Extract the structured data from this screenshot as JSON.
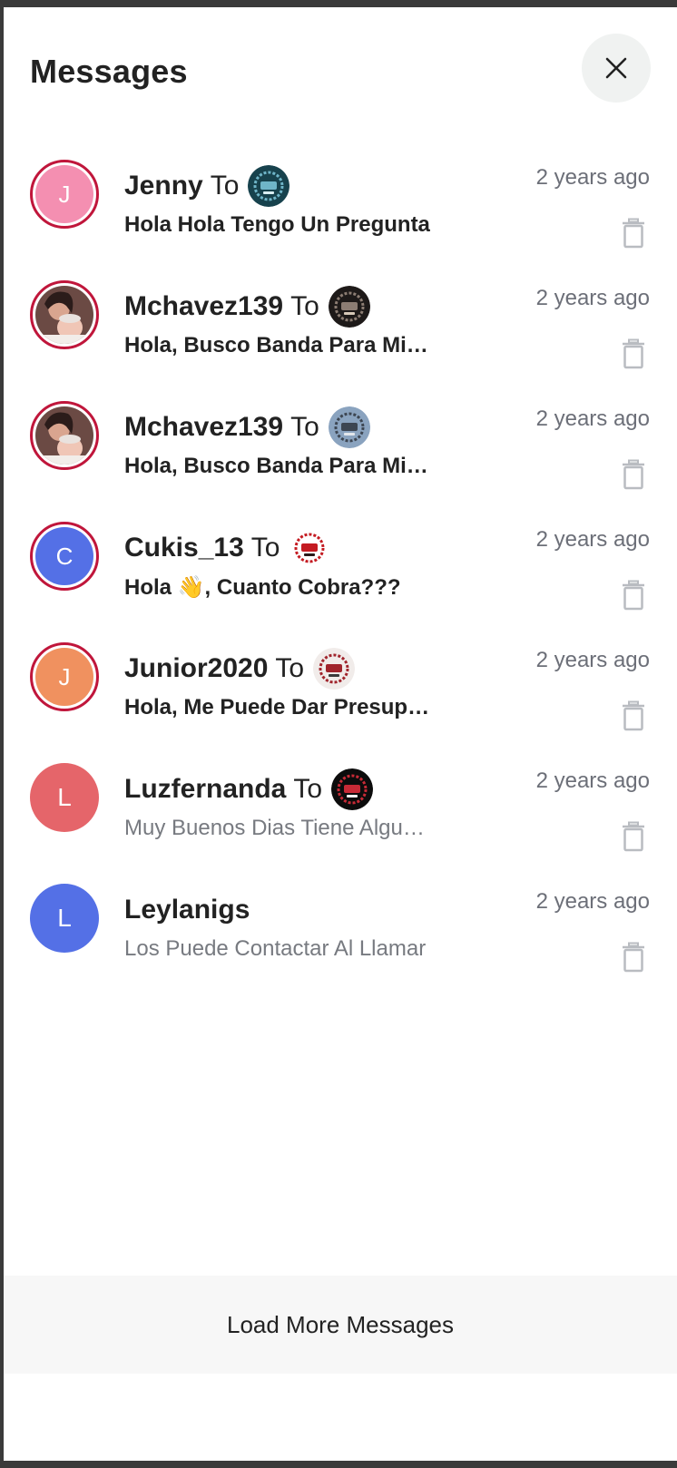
{
  "header": {
    "title": "Messages",
    "close_icon": "close-icon"
  },
  "colors": {
    "ring": "#c0163b",
    "timestamp": "#6c6f78",
    "read_preview": "#777a80",
    "footer_bg": "#f7f7f7"
  },
  "messages": [
    {
      "initial": "J",
      "avatar_color": "#f48fb1",
      "avatar_type": "initial",
      "ring": true,
      "sender": "Jenny",
      "to_label": "To",
      "recipient_icon": "band-logo-teal",
      "preview": "Hola Hola Tengo Un Pregunta",
      "unread": true,
      "time": "2 years ago",
      "delete_icon": "trash-icon"
    },
    {
      "initial": "",
      "avatar_color": "#c98b7b",
      "avatar_type": "photo",
      "ring": true,
      "sender": "Mchavez139",
      "to_label": "To",
      "recipient_icon": "band-logo-dark",
      "preview": "Hola, Busco Banda Para Mi Evento",
      "unread": true,
      "time": "2 years ago",
      "delete_icon": "trash-icon"
    },
    {
      "initial": "",
      "avatar_color": "#c98b7b",
      "avatar_type": "photo",
      "ring": true,
      "sender": "Mchavez139",
      "to_label": "To",
      "recipient_icon": "band-logo-grey",
      "preview": "Hola, Busco Banda Para Mi Evento",
      "unread": true,
      "time": "2 years ago",
      "delete_icon": "trash-icon"
    },
    {
      "initial": "C",
      "avatar_color": "#5470e6",
      "avatar_type": "initial",
      "ring": true,
      "sender": "Cukis_13",
      "to_label": "To",
      "recipient_icon": "band-logo-red",
      "preview": "Hola 👋, Cuanto Cobra???",
      "unread": true,
      "time": "2 years ago",
      "delete_icon": "trash-icon"
    },
    {
      "initial": "J",
      "avatar_color": "#f0915f",
      "avatar_type": "initial",
      "ring": true,
      "sender": "Junior2020",
      "to_label": "To",
      "recipient_icon": "band-logo-group",
      "preview": "Hola, Me Puede Dar Presupuesto",
      "unread": true,
      "time": "2 years ago",
      "delete_icon": "trash-icon"
    },
    {
      "initial": "L",
      "avatar_color": "#e5656a",
      "avatar_type": "initial",
      "ring": false,
      "sender": "Luzfernanda",
      "to_label": "To",
      "recipient_icon": "band-logo-black",
      "preview": "Muy Buenos Dias Tiene Algun Paquete",
      "unread": false,
      "time": "2 years ago",
      "delete_icon": "trash-icon"
    },
    {
      "initial": "L",
      "avatar_color": "#5470e6",
      "avatar_type": "initial",
      "ring": false,
      "sender": "Leylanigs",
      "to_label": "",
      "recipient_icon": "",
      "preview": "Los Puede Contactar Al Llamar",
      "unread": false,
      "time": "2 years ago",
      "delete_icon": "trash-icon"
    }
  ],
  "footer": {
    "load_more_label": "Load More Messages"
  }
}
